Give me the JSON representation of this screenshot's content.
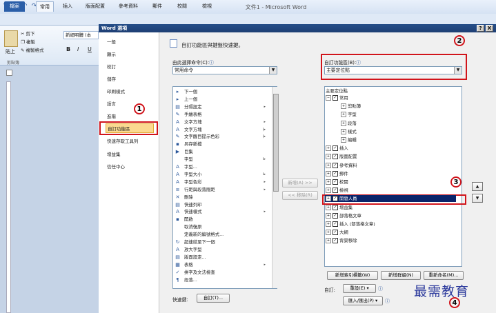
{
  "window": {
    "title": "文件1 - Microsoft Word"
  },
  "ribbon": {
    "tabs": [
      "檔案",
      "常用",
      "插入",
      "版面配置",
      "參考資料",
      "郵件",
      "校閱",
      "檢視"
    ],
    "cut": "剪下",
    "copy": "複製",
    "paste": "貼上",
    "format_painter": "複製格式",
    "clipboard_group": "剪貼簿",
    "font_name": "新細明體 (本"
  },
  "dialog": {
    "title": "Word 選項",
    "help": "?",
    "close": "X",
    "nav": [
      "一般",
      "顯示",
      "校訂",
      "儲存",
      "印刷樣式",
      "語言",
      "進階",
      "自訂功能區",
      "快速存取工具列",
      "增益集",
      "信任中心"
    ],
    "header": "自訂功能區與鍵盤快速鍵。",
    "choose_label": "由此選擇命令(C):",
    "choose_value": "常用命令",
    "customize_label": "自訂功能區(B):",
    "customize_value": "主要定位點",
    "commands": [
      "下一個",
      "上一個",
      "分隔設定",
      "手繪表格",
      "文字方塊",
      "文字方塊",
      "文字醒目提示色彩",
      "另存新檔",
      "巨集",
      "字型",
      "字型...",
      "字型大小",
      "字型色彩",
      "行距與段落間距",
      "刪除",
      "快速列印",
      "快速樣式",
      "開啟",
      "取消復原",
      "定義新的編號格式...",
      "超連結至下一個",
      "放大字型",
      "版面設定...",
      "表格",
      "拼字及文法檢查",
      "段落..."
    ],
    "add_button": "新增(A) >>",
    "remove_button": "<< 移除(R)",
    "tree_header": "主要定位點",
    "tree": [
      {
        "label": "常用",
        "level": 0,
        "exp": "−",
        "check": true
      },
      {
        "label": "剪貼簿",
        "level": 1,
        "exp": "+",
        "check": false
      },
      {
        "label": "字型",
        "level": 1,
        "exp": "+",
        "check": false
      },
      {
        "label": "段落",
        "level": 1,
        "exp": "+",
        "check": false
      },
      {
        "label": "樣式",
        "level": 1,
        "exp": "+",
        "check": false
      },
      {
        "label": "編輯",
        "level": 1,
        "exp": "+",
        "check": false
      },
      {
        "label": "插入",
        "level": 0,
        "exp": "+",
        "check": true
      },
      {
        "label": "版面配置",
        "level": 0,
        "exp": "+",
        "check": true
      },
      {
        "label": "參考資料",
        "level": 0,
        "exp": "+",
        "check": true
      },
      {
        "label": "郵件",
        "level": 0,
        "exp": "+",
        "check": true
      },
      {
        "label": "校閱",
        "level": 0,
        "exp": "+",
        "check": true
      },
      {
        "label": "檢視",
        "level": 0,
        "exp": "+",
        "check": true
      },
      {
        "label": "開發人員",
        "level": 0,
        "exp": "+",
        "check": true
      },
      {
        "label": "增益集",
        "level": 0,
        "exp": "+",
        "check": true
      },
      {
        "label": "部落格文章",
        "level": 0,
        "exp": "+",
        "check": true
      },
      {
        "label": "插入 (部落格文章)",
        "level": 0,
        "exp": "+",
        "check": true
      },
      {
        "label": "大綱",
        "level": 0,
        "exp": "+",
        "check": true
      },
      {
        "label": "背景移除",
        "level": 0,
        "exp": "+",
        "check": true
      }
    ],
    "new_tab": "新增索引標籤(W)",
    "new_group": "新增群組(N)",
    "rename": "重新命名(M)...",
    "customize_label2": "自訂:",
    "reset": "重設(E) ▾",
    "import_export": "匯入/匯出(P) ▾",
    "shortcut_label": "快速鍵:",
    "shortcut_button": "自訂(T)..."
  },
  "steps": [
    "1",
    "2",
    "3",
    "4"
  ],
  "watermark": "最需教育",
  "colors": {
    "accent": "#2a5ea8",
    "selection": "#0a246a",
    "highlight": "#fbd990",
    "annotation": "#d1141b"
  }
}
